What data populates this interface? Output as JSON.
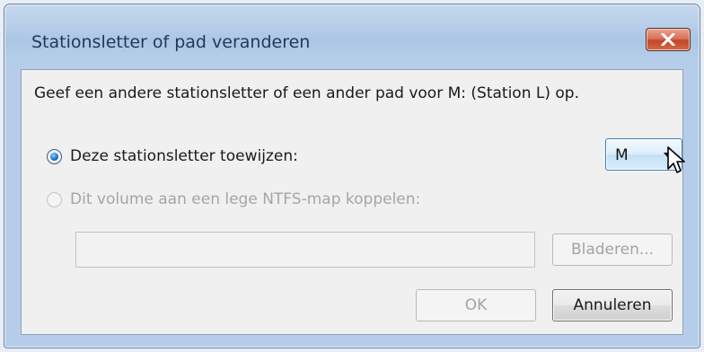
{
  "dialog": {
    "title": "Stationsletter of pad veranderen",
    "instruction": "Geef een andere stationsletter of een ander pad voor M: (Station L) op."
  },
  "options": {
    "assign_letter": {
      "label": "Deze stationsletter toewijzen:",
      "selected": true
    },
    "mount_folder": {
      "label": "Dit volume aan een lege NTFS-map koppelen:",
      "selected": false,
      "enabled": false
    }
  },
  "drive_letter_select": {
    "value": "M"
  },
  "folder_path": {
    "value": ""
  },
  "buttons": {
    "browse": "Bladeren...",
    "ok": "OK",
    "cancel": "Annuleren"
  },
  "icons": {
    "close": "close-x-icon",
    "dropdown": "chevron-down-icon",
    "cursor": "mouse-pointer-icon"
  },
  "colors": {
    "title_text": "#1e395b",
    "close_button": "#c4462b",
    "combo_border": "#3c7fb1",
    "disabled_text": "#a3a3a3"
  }
}
